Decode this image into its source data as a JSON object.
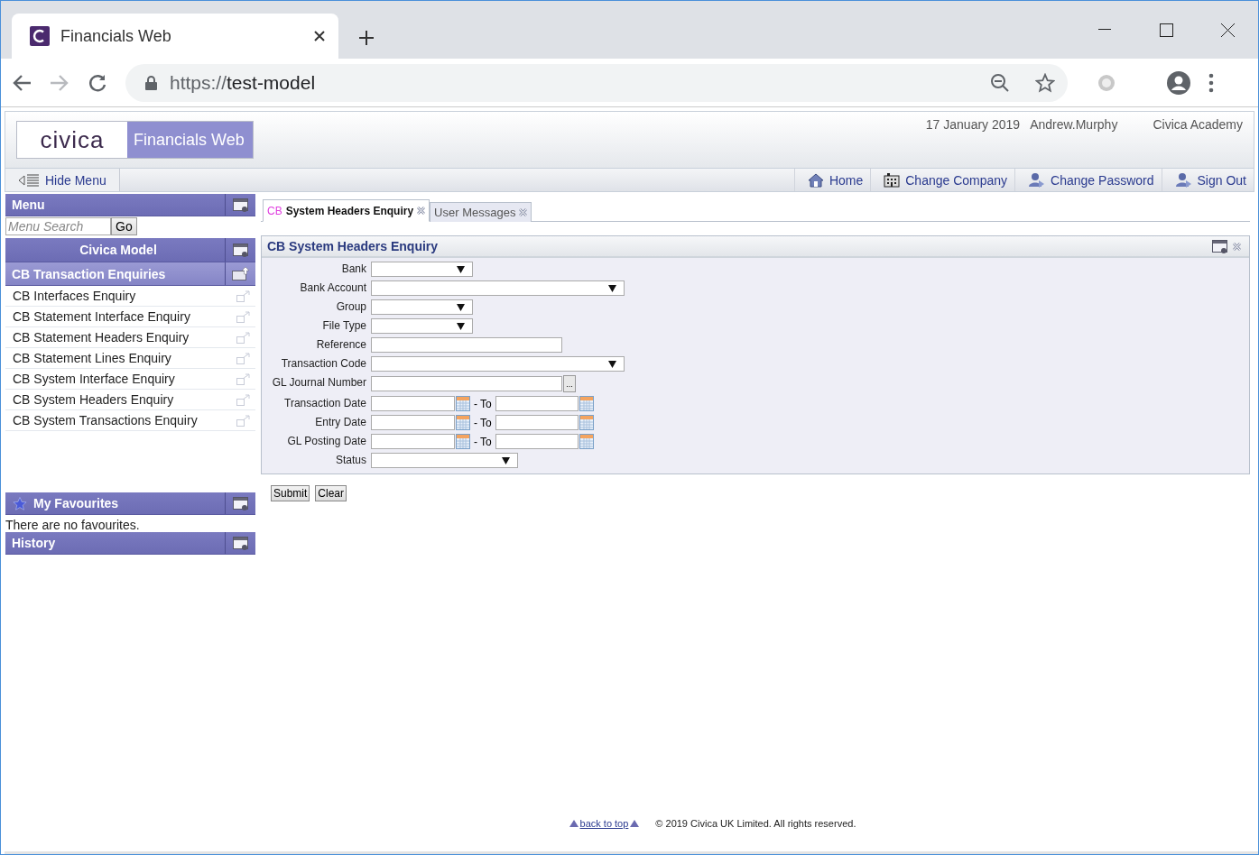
{
  "browser": {
    "tab_title": "Financials Web",
    "url_scheme": "https://",
    "url_host": "test-model"
  },
  "header": {
    "logo": "civica",
    "product": "Financials Web",
    "date": "17 January 2019",
    "user": "Andrew.Murphy",
    "organisation": "Civica Academy"
  },
  "navbar": {
    "hide_menu": "Hide Menu",
    "links": [
      {
        "kind": "home",
        "label": "Home"
      },
      {
        "kind": "company",
        "label": "Change Company"
      },
      {
        "kind": "password",
        "label": "Change Password"
      },
      {
        "kind": "signout",
        "label": "Sign Out"
      }
    ]
  },
  "sidebar": {
    "menu_title": "Menu",
    "search_placeholder": "Menu Search",
    "go": "Go",
    "model": "Civica Model",
    "section": "CB Transaction Enquiries",
    "items": [
      "CB Interfaces Enquiry",
      "CB Statement Interface Enquiry",
      "CB Statement Headers Enquiry",
      "CB Statement Lines Enquiry",
      "CB System Interface Enquiry",
      "CB System Headers Enquiry",
      "CB System Transactions Enquiry"
    ],
    "favourites_title": "My Favourites",
    "favourites_empty": "There are no favourites.",
    "history_title": "History"
  },
  "tabs": [
    {
      "prefix": "CB",
      "label": "System Headers Enquiry",
      "selected": true
    },
    {
      "label": "User Messages",
      "selected": false
    }
  ],
  "form": {
    "title": "CB System Headers Enquiry",
    "fields": [
      {
        "label": "Bank",
        "kind": "shortselect"
      },
      {
        "label": "Bank Account",
        "kind": "longselect"
      },
      {
        "label": "Group",
        "kind": "shortselect"
      },
      {
        "label": "File Type",
        "kind": "shortselect"
      },
      {
        "label": "Reference",
        "kind": "text"
      },
      {
        "label": "Transaction Code",
        "kind": "longselect"
      },
      {
        "label": "GL Journal Number",
        "kind": "lookup",
        "button": "..."
      },
      {
        "label": "Transaction Date",
        "kind": "daterange",
        "to": "- To"
      },
      {
        "label": "Entry Date",
        "kind": "daterange",
        "to": "- To"
      },
      {
        "label": "GL Posting Date",
        "kind": "daterange",
        "to": "- To"
      },
      {
        "label": "Status",
        "kind": "midselect"
      }
    ],
    "buttons": [
      "Submit",
      "Clear"
    ]
  },
  "footer": {
    "back_to_top": "back to top",
    "copyright": "© 2019 Civica UK Limited. All rights reserved."
  }
}
